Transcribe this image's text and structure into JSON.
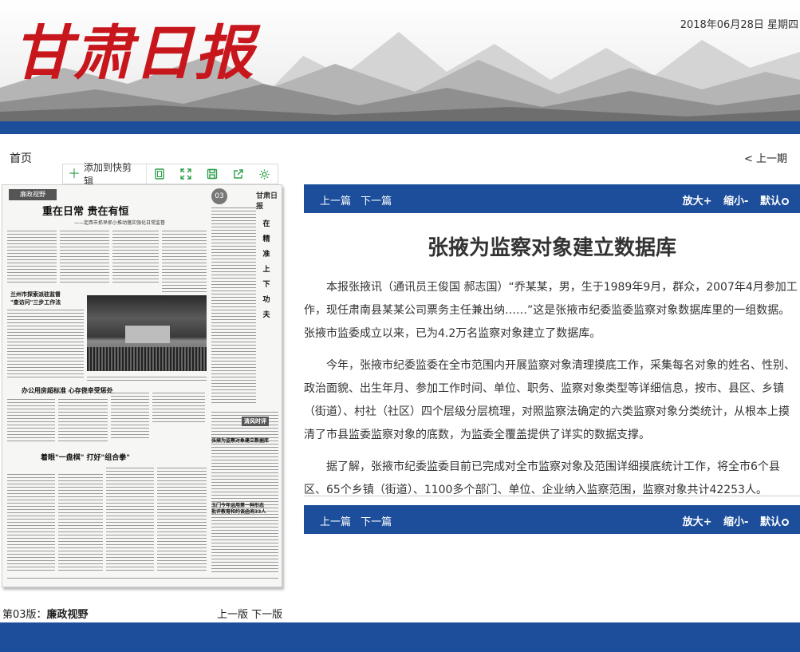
{
  "header": {
    "masthead": "甘肃日报",
    "date": "2018年06月28日  星期四"
  },
  "nav": {
    "home": "首页",
    "prev_issue": "< 上一期"
  },
  "toolbar": {
    "add_clip": "添加到快剪辑",
    "icons": [
      "window-icon",
      "expand-icon",
      "save-icon",
      "share-icon",
      "gear-icon"
    ]
  },
  "page_thumb": {
    "section_tag": "廉政视野",
    "page_no": "03",
    "masthead": "甘肃日报",
    "headline": "重在日常  贵在有恒",
    "subhead": "——定西市抓早抓小推动落实强化日常监督",
    "box1": "兰州市探索派驻监督\n\"查访问\"三步工作法",
    "box2": "办公用房超标准  心存侥幸受惩处",
    "box3": "着眼\"一盘棋\"  打好\"组合拳\"",
    "box4": "张掖为监察对象建立数据库",
    "box5": "玉门今年运用第一种形态\n批评教育和约谈函询33人",
    "vertical": [
      "在",
      "精",
      "准",
      "上",
      "下",
      "功",
      "夫"
    ],
    "side_badge": "清风时评"
  },
  "page_info": {
    "page": "第03版：",
    "section": "廉政视野",
    "prev": "上一版",
    "next": "下一版"
  },
  "article_bar": {
    "prev": "上一篇",
    "next": "下一篇",
    "zoom_in": "放大+",
    "zoom_out": "缩小-",
    "default": "默认"
  },
  "article": {
    "title": "张掖为监察对象建立数据库",
    "paragraphs": [
      "本报张掖讯（通讯员王俊国 郝志国）“乔某某，男，生于1989年9月，群众，2007年4月参加工作，现任肃南县某某公司票务主任兼出纳……”这是张掖市纪委监委监察对象数据库里的一组数据。张掖市监委成立以来，已为4.2万名监察对象建立了数据库。",
      "今年，张掖市纪委监委在全市范围内开展监察对象清理摸底工作，采集每名对象的姓名、性别、政治面貌、出生年月、参加工作时间、单位、职务、监察对象类型等详细信息，按市、县区、乡镇（街道）、村社（社区）四个层级分层梳理，对照监察法确定的六类监察对象分类统计，从根本上摸清了市县监委监察对象的底数，为监委全覆盖提供了详实的数据支撑。",
      "据了解，张掖市纪委监委目前已完成对全市监察对象及范围详细摸底统计工作，将全市6个县区、65个乡镇（街道）、1100多个部门、单位、企业纳入监察范围，监察对象共计42253人。"
    ]
  }
}
